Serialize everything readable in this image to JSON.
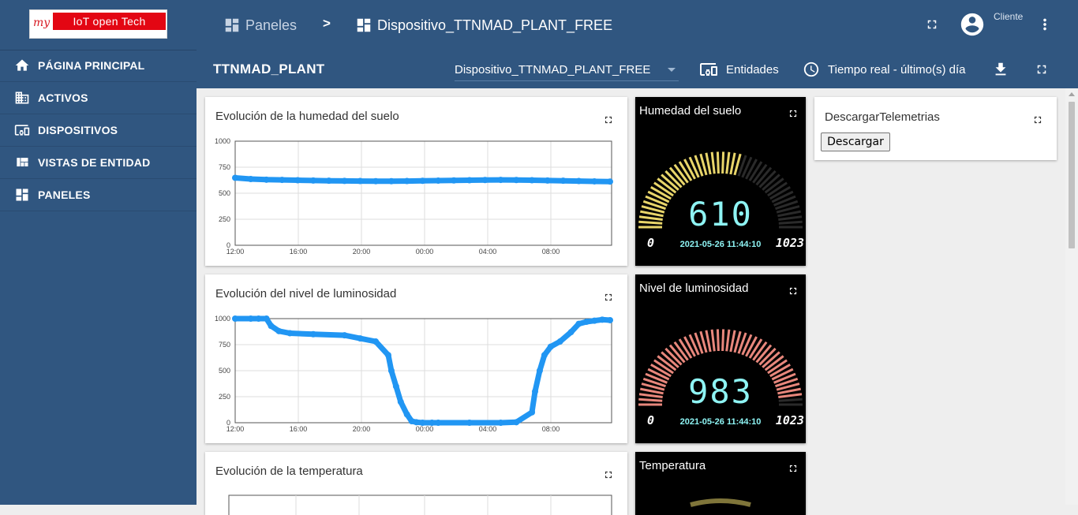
{
  "logo": {
    "prefix": "my",
    "text": "IoT open Tech"
  },
  "sidebar": {
    "items": [
      {
        "label": "PÁGINA PRINCIPAL",
        "icon": "home-icon"
      },
      {
        "label": "ACTIVOS",
        "icon": "domain-icon"
      },
      {
        "label": "DISPOSITIVOS",
        "icon": "devices-icon"
      },
      {
        "label": "VISTAS DE ENTIDAD",
        "icon": "view-quilt-icon"
      },
      {
        "label": "PANELES",
        "icon": "dashboard-icon"
      }
    ]
  },
  "header": {
    "breadcrumb": [
      {
        "label": "Paneles",
        "icon": "dashboard-icon"
      },
      {
        "label": "Dispositivo_TTNMAD_PLANT_FREE",
        "icon": "dashboard-icon"
      }
    ],
    "breadcrumb_separator": ">",
    "user_label": "Cliente"
  },
  "toolbar": {
    "dashboard_title": "TTNMAD_PLANT",
    "device_selected": "Dispositivo_TTNMAD_PLANT_FREE",
    "entities_label": "Entidades",
    "time_label": "Tiempo real - último(s) día"
  },
  "widgets": {
    "soil_chart": {
      "title": "Evolución de la humedad del suelo"
    },
    "light_chart": {
      "title": "Evolución del nivel de luminosidad"
    },
    "temp_chart": {
      "title": "Evolución de la temperatura"
    },
    "soil_gauge": {
      "title": "Humedad del suelo",
      "value": "610",
      "timestamp": "2021-05-26 11:44:10",
      "min": "0",
      "max": "1023",
      "fraction": 0.596,
      "color": "#e8d56a"
    },
    "light_gauge": {
      "title": "Nivel de luminosidad",
      "value": "983",
      "timestamp": "2021-05-26 11:44:10",
      "min": "0",
      "max": "1023",
      "fraction": 0.961,
      "color": "#e8877c"
    },
    "temp_gauge": {
      "title": "Temperatura"
    },
    "download": {
      "title": "DescargarTelemetrias",
      "button_label": "Descargar"
    }
  },
  "chart_data": [
    {
      "type": "scatter",
      "x_ticks": [
        "12:00",
        "16:00",
        "20:00",
        "00:00",
        "04:00",
        "08:00"
      ],
      "y_ticks": [
        "0",
        "250",
        "500",
        "750",
        "1000"
      ],
      "ylim": [
        0,
        1000
      ],
      "x_hours": [
        0,
        1,
        2,
        3,
        4,
        5,
        6,
        7,
        8,
        9,
        10,
        11,
        12,
        13,
        14,
        15,
        16,
        17,
        18,
        19,
        20,
        21,
        22,
        23,
        24
      ],
      "y": [
        648,
        636,
        630,
        628,
        625,
        622,
        620,
        618,
        617,
        616,
        616,
        617,
        619,
        621,
        623,
        625,
        627,
        628,
        627,
        625,
        622,
        620,
        617,
        614,
        612
      ],
      "color": "#2196f3"
    },
    {
      "type": "scatter",
      "x_ticks": [
        "12:00",
        "16:00",
        "20:00",
        "00:00",
        "04:00",
        "08:00"
      ],
      "y_ticks": [
        "0",
        "250",
        "500",
        "750",
        "1000"
      ],
      "ylim": [
        0,
        1000
      ],
      "x_hours": [
        0,
        1,
        1.5,
        2,
        2.3,
        2.8,
        3.5,
        5,
        7,
        8,
        9,
        9.8,
        10,
        10.3,
        10.6,
        11,
        11.3,
        11.6,
        12,
        12.6,
        13,
        15,
        17,
        18,
        19,
        19.2,
        19.5,
        19.8,
        20.2,
        20.8,
        21.5,
        22,
        22.5,
        23,
        23.5,
        24
      ],
      "y": [
        1000,
        1000,
        1000,
        1000,
        930,
        880,
        860,
        850,
        840,
        810,
        780,
        650,
        500,
        350,
        200,
        80,
        15,
        5,
        0,
        0,
        0,
        0,
        0,
        5,
        100,
        300,
        500,
        650,
        730,
        780,
        870,
        950,
        970,
        980,
        990,
        985
      ],
      "color": "#2196f3"
    }
  ]
}
